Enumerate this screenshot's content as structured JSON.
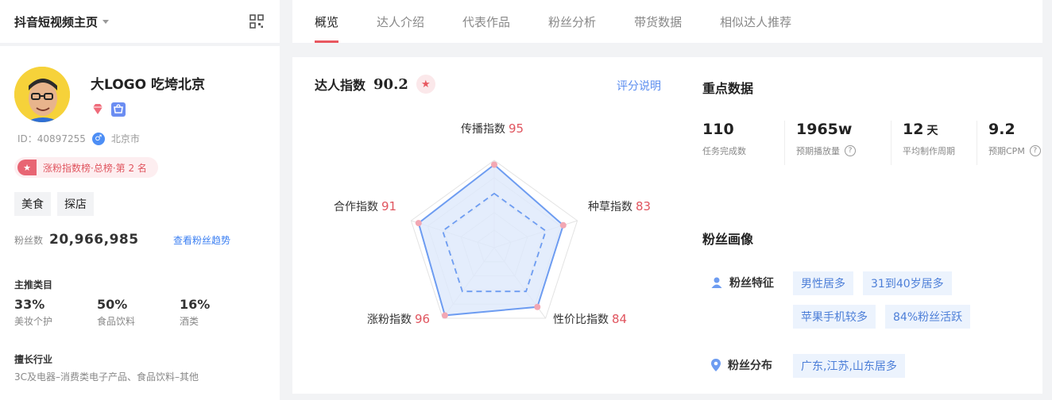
{
  "left_header": {
    "title": "抖音短视频主页"
  },
  "profile": {
    "name": "大LOGO 吃垮北京",
    "id_label": "ID：40897255",
    "location": "北京市",
    "rank": "涨粉指数榜·总榜·第 2 名",
    "tags": [
      "美食",
      "探店"
    ],
    "fans_label": "粉丝数",
    "fans_count": "20,966,985",
    "fans_trend_link": "查看粉丝趋势"
  },
  "main_categories": {
    "title": "主推类目",
    "items": [
      {
        "pct": "33%",
        "name": "美妆个护"
      },
      {
        "pct": "50%",
        "name": "食品饮料"
      },
      {
        "pct": "16%",
        "name": "酒类"
      }
    ]
  },
  "industry": {
    "title": "擅长行业",
    "value": "3C及电器–消费类电子产品、食品饮料–其他"
  },
  "tabs": [
    "概览",
    "达人介绍",
    "代表作品",
    "粉丝分析",
    "带货数据",
    "相似达人推荐"
  ],
  "active_tab": 0,
  "score": {
    "title": "达人指数",
    "value": "90.2",
    "explain_link": "评分说明"
  },
  "chart_data": {
    "type": "radar",
    "axes": [
      "传播指数",
      "种草指数",
      "性价比指数",
      "涨粉指数",
      "合作指数"
    ],
    "values": [
      95,
      83,
      84,
      96,
      91
    ],
    "max": 100,
    "reference_values": [
      62,
      62,
      62,
      62,
      62
    ],
    "colors": {
      "fill": "#dde8fb",
      "stroke": "#6d9cf1",
      "point": "#f2a7b3"
    }
  },
  "key_data": {
    "title": "重点数据",
    "items": [
      {
        "value": "110",
        "unit": "",
        "label": "任务完成数",
        "help": false
      },
      {
        "value": "1965w",
        "unit": "",
        "label": "预期播放量",
        "help": true
      },
      {
        "value": "12",
        "unit": "天",
        "label": "平均制作周期",
        "help": false
      },
      {
        "value": "9.2",
        "unit": "",
        "label": "预期CPM",
        "help": true
      }
    ]
  },
  "fan_profile": {
    "title": "粉丝画像",
    "features_label": "粉丝特征",
    "features": [
      "男性居多",
      "31到40岁居多",
      "苹果手机较多",
      "84%粉丝活跃"
    ],
    "distribution_label": "粉丝分布",
    "distribution": [
      "广东,江苏,山东居多"
    ]
  },
  "help_glyph": "?",
  "accent": "#e8575f"
}
